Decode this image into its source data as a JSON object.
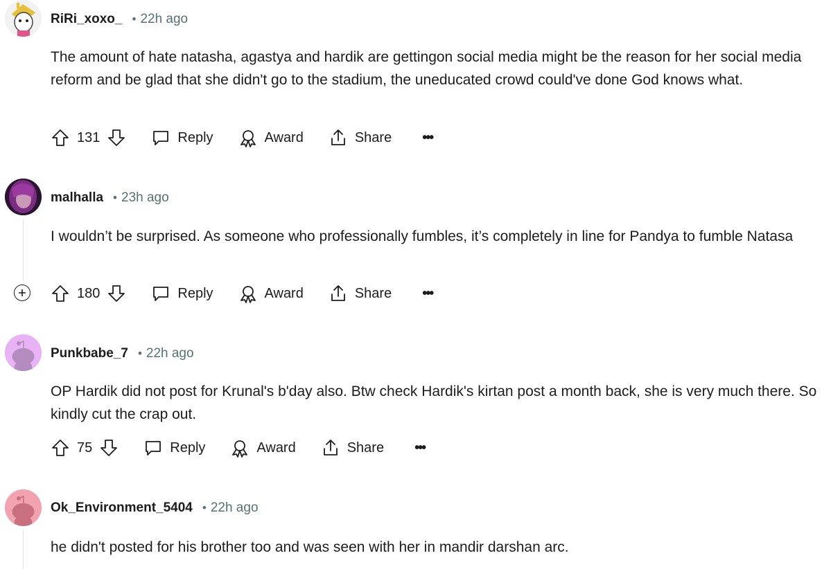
{
  "comments": [
    {
      "author": "RiRi_xoxo_",
      "separator": "•",
      "time": "22h ago",
      "text": "The amount of hate natasha, agastya and hardik are gettingon social media might be the reason for her social media reform and be glad that she didn't go to the stadium, the uneducated crowd could've done God knows what.",
      "score": "131",
      "reply": "Reply",
      "award": "Award",
      "share": "Share",
      "more": "•••"
    },
    {
      "author": "malhalla",
      "separator": "•",
      "time": "23h ago",
      "text": "I wouldn’t be surprised. As someone who professionally fumbles, it’s completely in line for Pandya to fumble Natasa",
      "score": "180",
      "reply": "Reply",
      "award": "Award",
      "share": "Share",
      "more": "•••"
    },
    {
      "author": "Punkbabe_7",
      "separator": "•",
      "time": "22h ago",
      "text": "OP Hardik did not post for Krunal's b'day also. Btw check Hardik's kirtan post a month back, she is very much there. So kindly cut the crap out.",
      "score": "75",
      "reply": "Reply",
      "award": "Award",
      "share": "Share",
      "more": "•••"
    },
    {
      "author": "Ok_Environment_5404",
      "separator": "•",
      "time": "22h ago",
      "text": "he didn't posted for his brother too and was seen with her in mandir darshan arc."
    }
  ],
  "colors": {
    "text": "#1c1c1c",
    "meta": "#576f76",
    "thread_line": "#e0e3e5",
    "avatar_purple_bg": "#e7b3f5",
    "avatar_pink_bg": "#f3a3b0"
  },
  "icons": {
    "upvote": "arrow-up-icon",
    "downvote": "arrow-down-icon",
    "reply": "speech-bubble-icon",
    "award": "award-ribbon-icon",
    "share": "share-upload-icon",
    "expand": "plus-circle-icon"
  }
}
